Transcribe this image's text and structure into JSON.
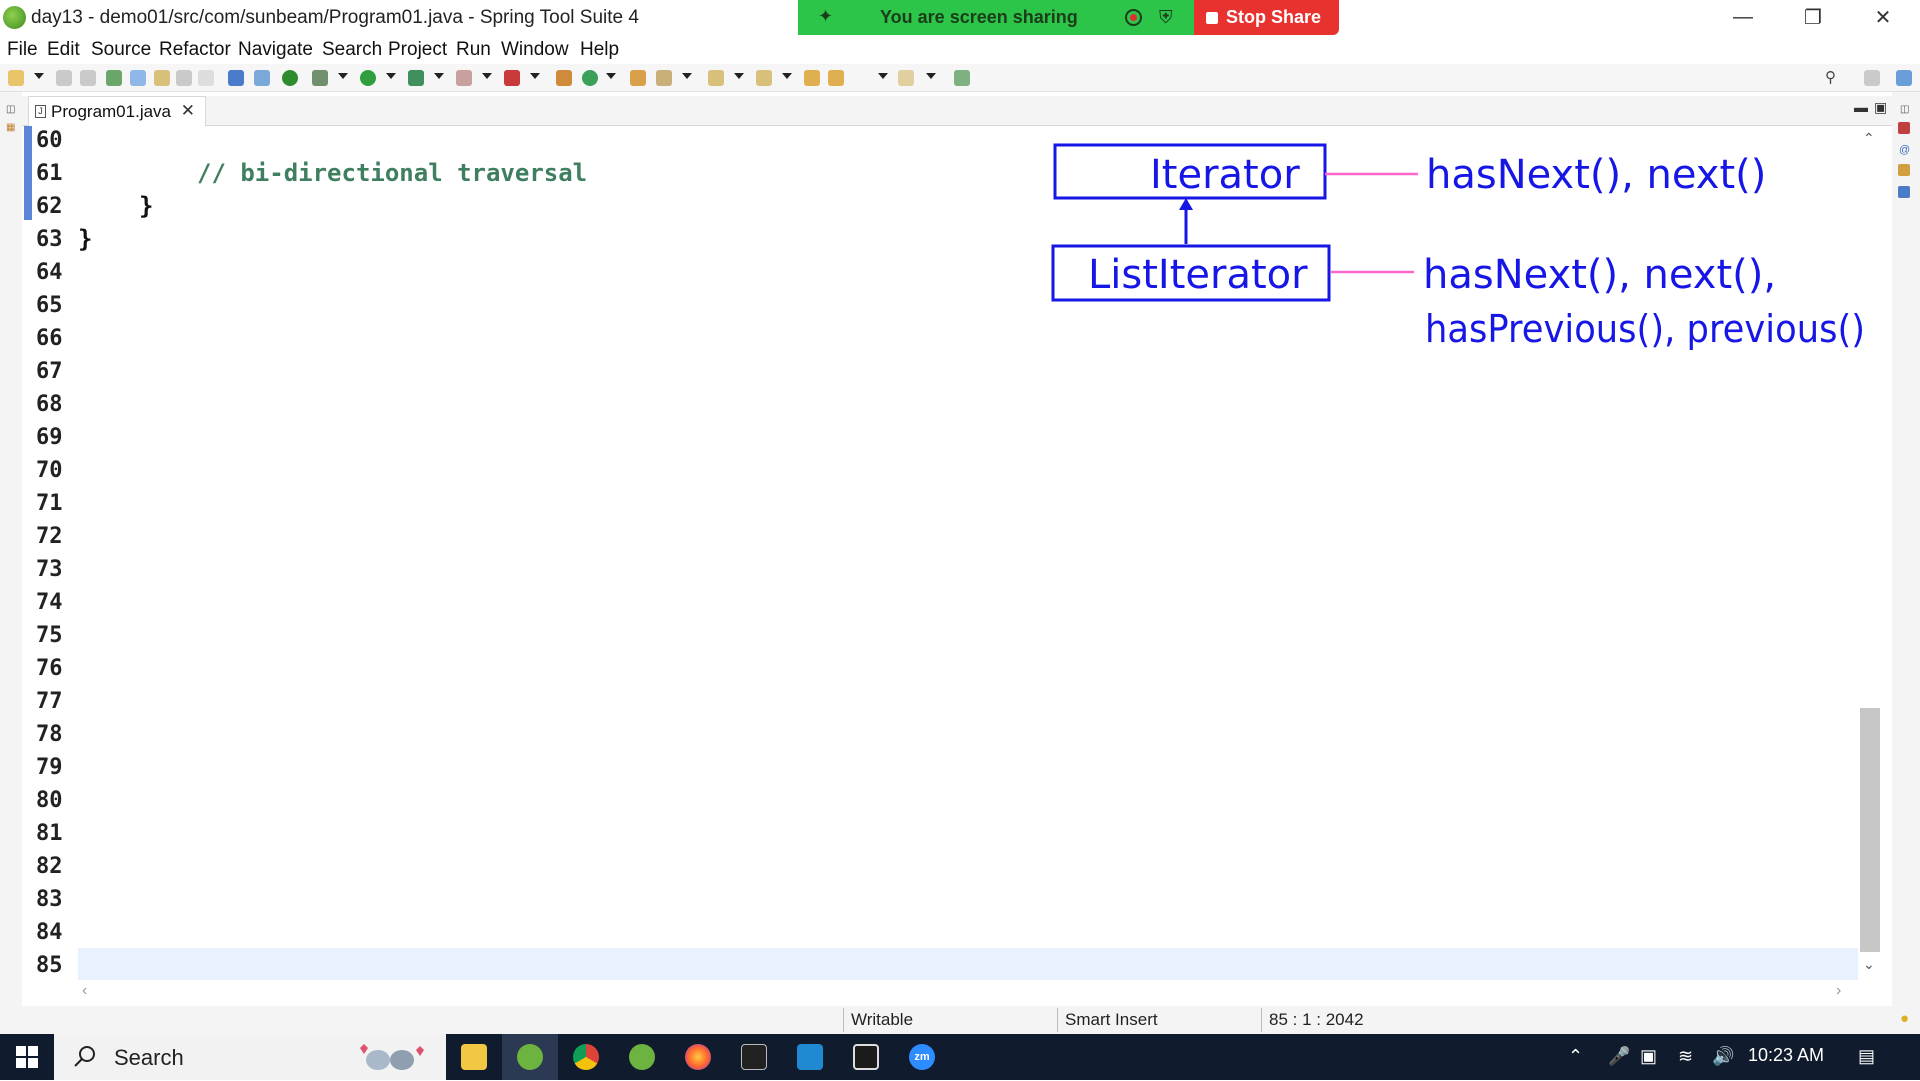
{
  "window": {
    "title": "day13 - demo01/src/com/sunbeam/Program01.java - Spring Tool Suite 4"
  },
  "screen_share": {
    "message": "You are screen sharing",
    "stop_label": "Stop Share",
    "green": "#2dc44a",
    "red": "#e8322f"
  },
  "menu": [
    "File",
    "Edit",
    "Source",
    "Refactor",
    "Navigate",
    "Search",
    "Project",
    "Run",
    "Window",
    "Help"
  ],
  "editor": {
    "tab_label": "Program01.java",
    "line_numbers": [
      "60",
      "61",
      "62",
      "63",
      "64",
      "65",
      "66",
      "67",
      "68",
      "69",
      "70",
      "71",
      "72",
      "73",
      "74",
      "75",
      "76",
      "77",
      "78",
      "79",
      "80",
      "81",
      "82",
      "83",
      "84",
      "85"
    ],
    "code": {
      "comment": "// bi-directional traversal",
      "brace_inner": "}",
      "brace_outer": "}"
    },
    "comment_color": "#3f7f5f"
  },
  "annotation": {
    "color": "#1616e6",
    "connector_color": "#ff66cc",
    "box_iterator": "Iterator",
    "box_listiterator": "ListIterator",
    "iterator_methods": "hasNext(), next()",
    "listiterator_methods_1": "hasNext(), next(),",
    "listiterator_methods_2": "hasPrevious(), previous()"
  },
  "status": {
    "writable": "Writable",
    "insert_mode": "Smart Insert",
    "position": "85 : 1 : 2042"
  },
  "taskbar": {
    "search_placeholder": "Search",
    "time": "10:23 AM",
    "apps": [
      "file-explorer-icon",
      "spring-tool-suite-icon",
      "chrome-icon",
      "spring-icon",
      "firefox-icon",
      "terminal-icon",
      "vscode-icon",
      "screen-capture-icon",
      "zoom-icon"
    ],
    "zoom_label": "zm"
  }
}
